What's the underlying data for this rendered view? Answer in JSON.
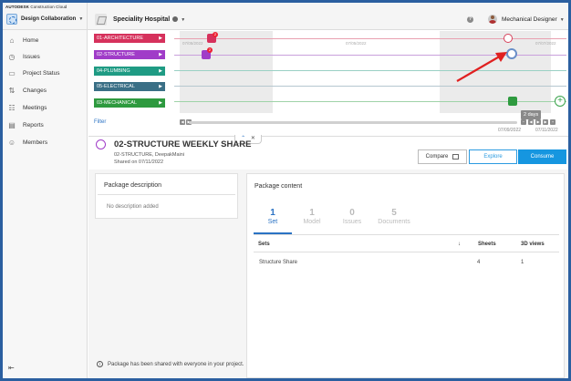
{
  "brand": {
    "name": "AUTODESK",
    "product": "Construction Cloud"
  },
  "hub": {
    "name": "Design Collaboration"
  },
  "project": {
    "name": "Speciality Hospital"
  },
  "user": {
    "name": "Mechanical Designer"
  },
  "sidebar": {
    "items": [
      {
        "label": "Home",
        "icon": "home-icon"
      },
      {
        "label": "Issues",
        "icon": "issues-icon"
      },
      {
        "label": "Project Status",
        "icon": "project-status-icon"
      },
      {
        "label": "Changes",
        "icon": "changes-icon"
      },
      {
        "label": "Meetings",
        "icon": "meetings-icon"
      },
      {
        "label": "Reports",
        "icon": "reports-icon"
      },
      {
        "label": "Members",
        "icon": "members-icon"
      }
    ]
  },
  "timeline": {
    "teams": [
      {
        "label": "01-ARCHITECTURE",
        "color": "#d6315c"
      },
      {
        "label": "02-STRUCTURE",
        "color": "#a03cc8"
      },
      {
        "label": "04-PLUMBING",
        "color": "#1f9b84"
      },
      {
        "label": "05-ELECTRICAL",
        "color": "#3a6f86"
      },
      {
        "label": "03-MECHANICAL",
        "color": "#2e9a3f"
      }
    ],
    "filter_label": "Filter",
    "dates": [
      "07/05/2022",
      "07/05/2022",
      "07/07/2022"
    ],
    "badges": [
      "2",
      "2"
    ],
    "range_label": "2 days",
    "range_start": "07/09/2022",
    "range_end": "07/11/2022"
  },
  "package": {
    "title": "02-STRUCTURE WEEKLY SHARE",
    "owner": "02-STRUCTURE, DeepakMaini",
    "shared": "Shared on 07/11/2022",
    "compare_label": "Compare",
    "explore_label": "Explore",
    "consume_label": "Consume"
  },
  "description": {
    "title": "Package description",
    "empty": "No description added"
  },
  "content": {
    "title": "Package content",
    "tabs": [
      {
        "num": "1",
        "label": "Set"
      },
      {
        "num": "1",
        "label": "Model"
      },
      {
        "num": "0",
        "label": "Issues"
      },
      {
        "num": "5",
        "label": "Documents"
      }
    ],
    "columns": {
      "sets": "Sets",
      "sheets": "Sheets",
      "views": "3D views"
    },
    "rows": [
      {
        "name": "Structure Share",
        "sheets": "4",
        "views": "1"
      }
    ]
  },
  "footer": {
    "info": "Package has been shared with everyone in your project."
  }
}
